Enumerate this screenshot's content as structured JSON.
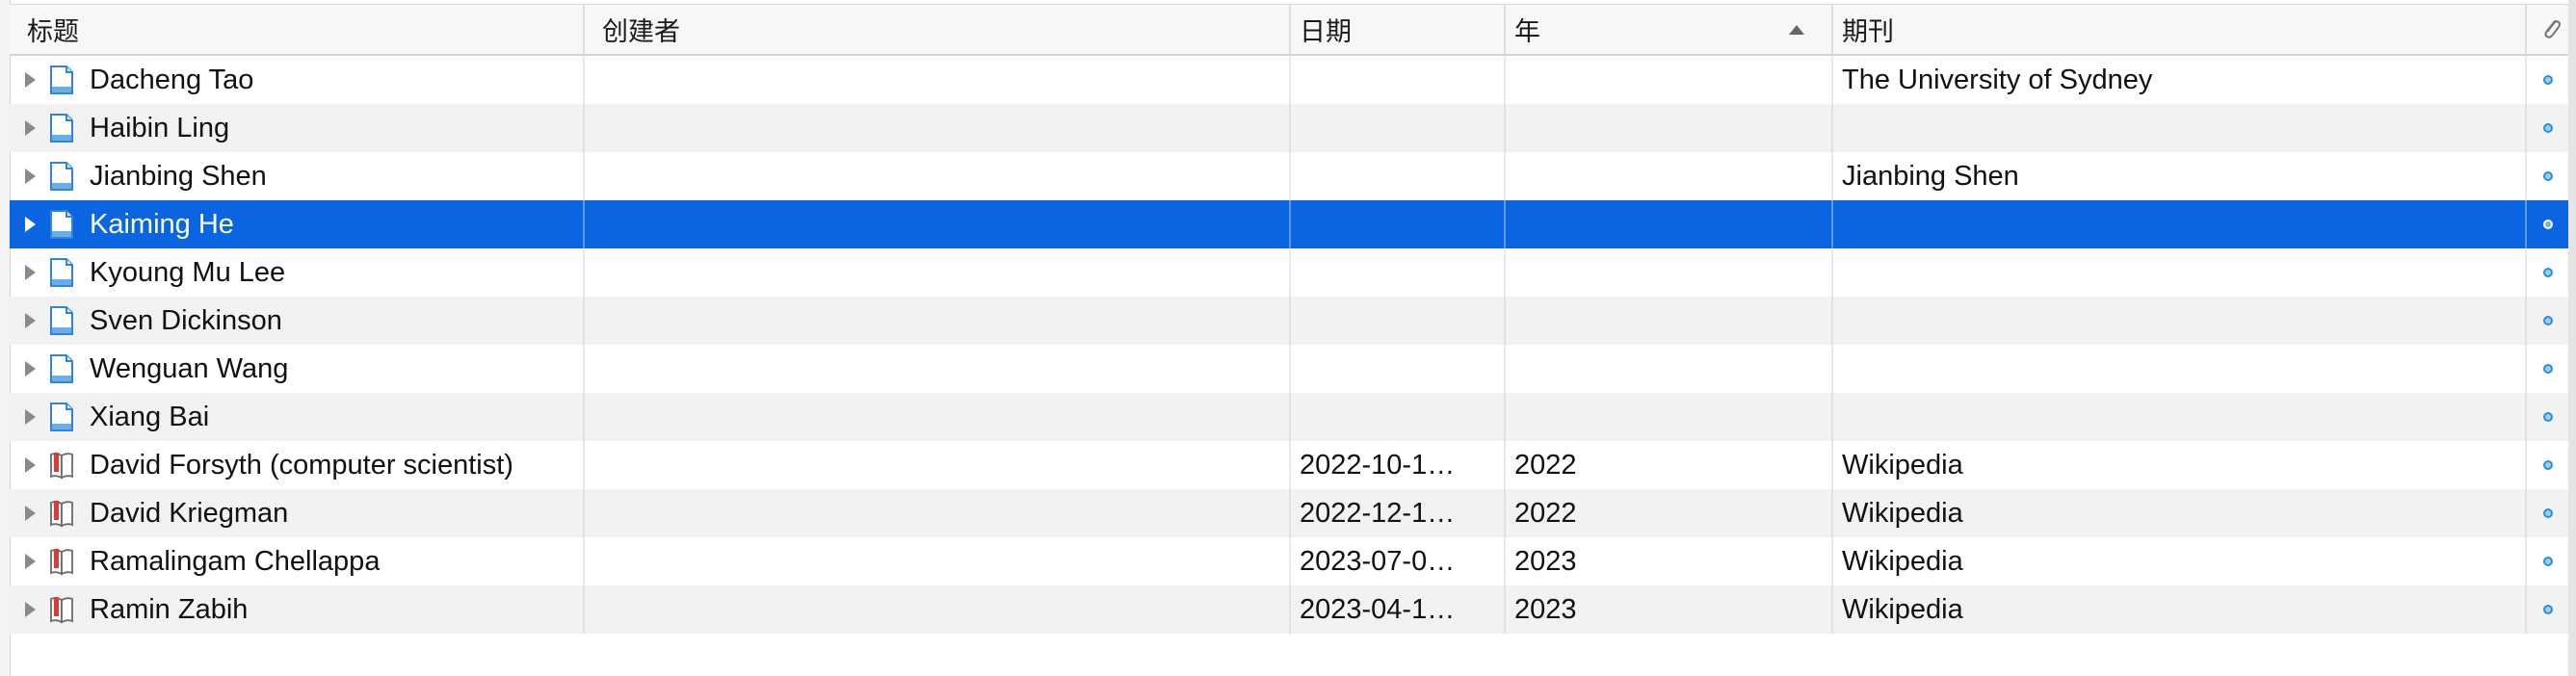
{
  "columns": {
    "title": "标题",
    "creator": "创建者",
    "date": "日期",
    "year": "年",
    "publication": "期刊"
  },
  "icons": {
    "sort": "sort-ascending-icon",
    "attachments_header": "paperclip-icon",
    "webpage": "webpage-icon",
    "encyclopedia": "encyclopedia-article-icon",
    "attachment_dot": "attachment-dot-icon",
    "expand": "disclosure-triangle-icon"
  },
  "colors": {
    "selection": "#0966e0",
    "alt_row": "#f2f2f2",
    "webpage_icon": "#2f86d8",
    "book_icon": "#d93b3b",
    "dot": "#2b8fd6"
  },
  "rows": [
    {
      "title": "Dacheng Tao",
      "creator": "",
      "date": "",
      "year": "",
      "publication": "The University of Sydney",
      "type": "webpage"
    },
    {
      "title": "Haibin Ling",
      "creator": "",
      "date": "",
      "year": "",
      "publication": "",
      "type": "webpage"
    },
    {
      "title": "Jianbing Shen",
      "creator": "",
      "date": "",
      "year": "",
      "publication": "Jianbing Shen",
      "type": "webpage"
    },
    {
      "title": "Kaiming He",
      "creator": "",
      "date": "",
      "year": "",
      "publication": "",
      "type": "webpage",
      "selected": true
    },
    {
      "title": "Kyoung Mu Lee",
      "creator": "",
      "date": "",
      "year": "",
      "publication": "",
      "type": "webpage"
    },
    {
      "title": "Sven Dickinson",
      "creator": "",
      "date": "",
      "year": "",
      "publication": "",
      "type": "webpage"
    },
    {
      "title": "Wenguan Wang",
      "creator": "",
      "date": "",
      "year": "",
      "publication": "",
      "type": "webpage"
    },
    {
      "title": "Xiang Bai",
      "creator": "",
      "date": "",
      "year": "",
      "publication": "",
      "type": "webpage"
    },
    {
      "title": "David Forsyth (computer scientist)",
      "creator": "",
      "date": "2022-10-1…",
      "year": "2022",
      "publication": "Wikipedia",
      "type": "encyclopedia"
    },
    {
      "title": "David Kriegman",
      "creator": "",
      "date": "2022-12-1…",
      "year": "2022",
      "publication": "Wikipedia",
      "type": "encyclopedia"
    },
    {
      "title": "Ramalingam Chellappa",
      "creator": "",
      "date": "2023-07-0…",
      "year": "2023",
      "publication": "Wikipedia",
      "type": "encyclopedia"
    },
    {
      "title": "Ramin Zabih",
      "creator": "",
      "date": "2023-04-1…",
      "year": "2023",
      "publication": "Wikipedia",
      "type": "encyclopedia"
    }
  ]
}
